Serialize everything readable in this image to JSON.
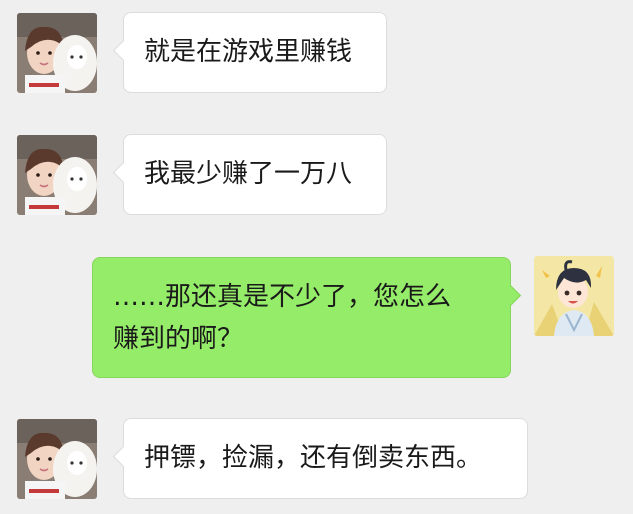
{
  "conversation": {
    "messages": [
      {
        "sender": "other",
        "text": "就是在游戏里赚钱"
      },
      {
        "sender": "other",
        "text": "我最少赚了一万八"
      },
      {
        "sender": "self",
        "lines": [
          "……那还真是不少了，您怎么",
          "赚到的啊？"
        ]
      },
      {
        "sender": "other",
        "text": "押镖，捡漏，还有倒卖东西。"
      }
    ]
  },
  "colors": {
    "background": "#efefef",
    "incoming_bubble": "#ffffff",
    "outgoing_bubble": "#95ec69"
  }
}
